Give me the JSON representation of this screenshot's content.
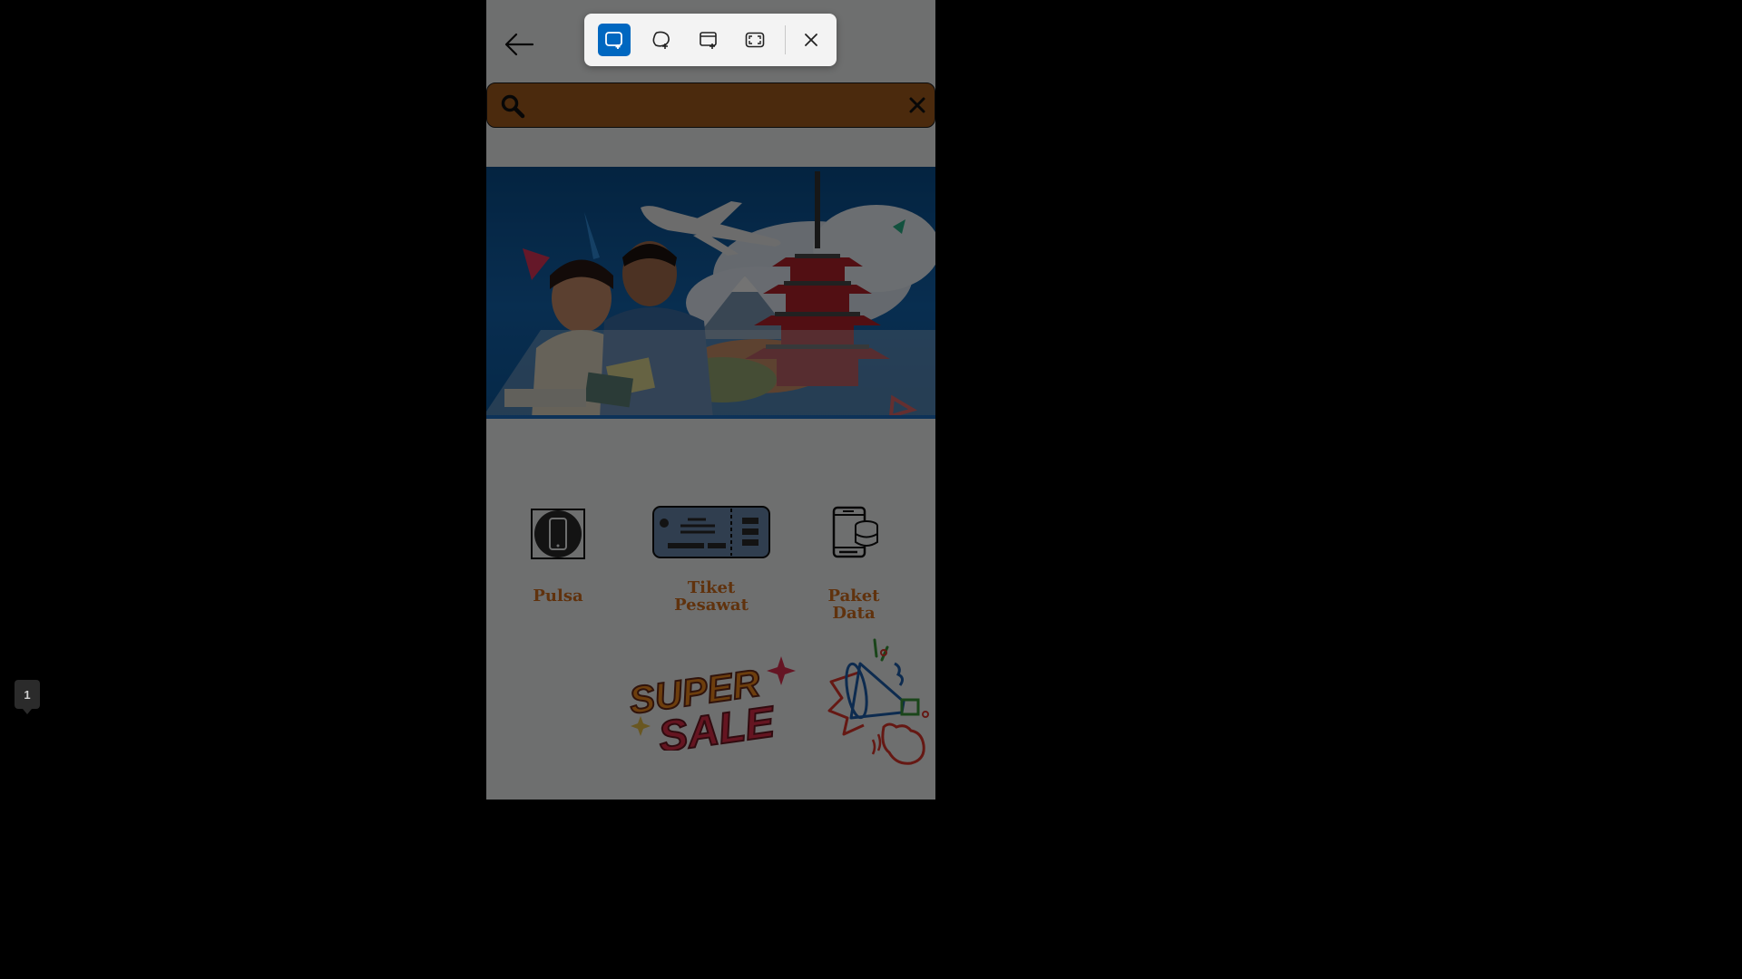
{
  "search": {
    "placeholder": "",
    "value": ""
  },
  "menu": {
    "items": [
      {
        "label": "Pulsa",
        "icon": "phone-icon"
      },
      {
        "label": "Tiket Pesawat",
        "label_line1": "Tiket",
        "label_line2": "Pesawat",
        "icon": "ticket-icon"
      },
      {
        "label": "Paket Data",
        "icon": "phone-data-icon"
      }
    ]
  },
  "promos": {
    "super_sale_line1": "SUPER",
    "super_sale_line2": "SALE",
    "megaphone_icon": "megaphone-icon"
  },
  "snipping_toolbar": {
    "modes": [
      "rectangle-snip-icon",
      "freeform-snip-icon",
      "window-snip-icon",
      "fullscreen-snip-icon"
    ],
    "active_mode": "rectangle-snip-icon",
    "close_icon": "close-icon"
  },
  "page_indicator": {
    "value": "1"
  },
  "colors": {
    "search_bar": "#a65d1e",
    "menu_label": "#d4701e",
    "banner_bg": "#1366b1",
    "snip_active": "#0067c0"
  }
}
